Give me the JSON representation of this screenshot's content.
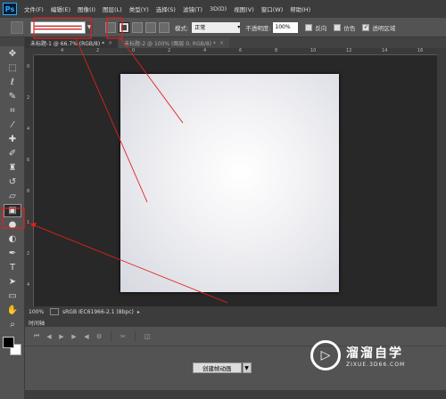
{
  "app": {
    "logo": "Ps"
  },
  "menu": [
    "文件(F)",
    "编辑(E)",
    "图像(I)",
    "图层(L)",
    "类型(Y)",
    "选择(S)",
    "滤镜(T)",
    "3D(D)",
    "视图(V)",
    "窗口(W)",
    "帮助(H)"
  ],
  "options": {
    "mode_label": "模式:",
    "mode_value": "正常",
    "opacity_label": "不透明度:",
    "opacity_value": "100%",
    "reverse_label": "反向",
    "dither_label": "仿色",
    "transparency_label": "透明区域",
    "gradient_types": [
      "linear",
      "radial",
      "angle",
      "reflected",
      "diamond"
    ],
    "active_gradient": "radial"
  },
  "tabs": [
    {
      "label": "未标题-1 @ 66.7% (RGB/8) *"
    },
    {
      "label": "未标题-2 @ 100% (图层 0, RGB/8) *"
    }
  ],
  "rulers": {
    "top": [
      "4",
      "2",
      "0",
      "2",
      "4",
      "6",
      "8",
      "10",
      "12",
      "14",
      "16"
    ],
    "left": [
      "0",
      "2",
      "4",
      "6",
      "8",
      "1",
      "2",
      "4"
    ]
  },
  "status": {
    "zoom": "100%",
    "profile": "sRGB IEC61966-2.1 (8bpc)"
  },
  "timeline": {
    "title": "时间轴",
    "create_label": "创建帧动画"
  },
  "watermark": {
    "name": "溜溜自学",
    "url": "ZIXUE.3D66.COM"
  },
  "colors": {
    "annotation": "#e02020",
    "canvas_bg": "#282828",
    "ui_bg": "#535353"
  },
  "icons": [
    "move-icon",
    "marquee-icon",
    "lasso-icon",
    "quick-select-icon",
    "crop-icon",
    "eyedropper-icon",
    "healing-icon",
    "brush-icon",
    "clone-stamp-icon",
    "history-brush-icon",
    "eraser-icon",
    "gradient-icon",
    "blur-icon",
    "dodge-icon",
    "pen-icon",
    "type-icon",
    "path-select-icon",
    "shape-icon",
    "hand-icon",
    "zoom-icon"
  ]
}
